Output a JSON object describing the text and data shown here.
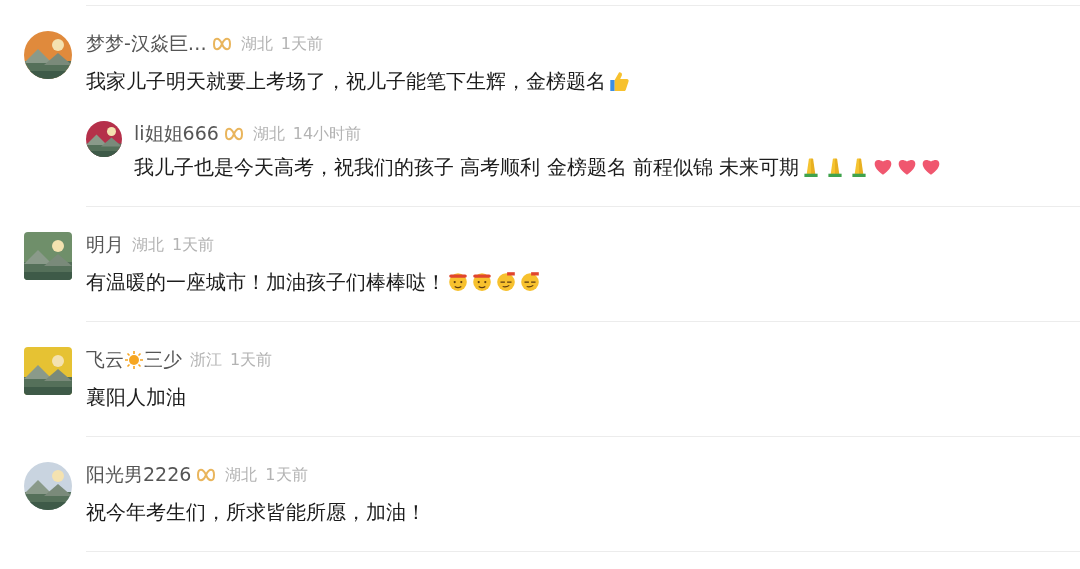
{
  "comments": [
    {
      "avatar": {
        "kind": "round"
      },
      "vip": true,
      "name": [
        {
          "kind": "text",
          "text": "梦梦-汉焱巨…"
        }
      ],
      "location": "湖北",
      "time": "1天前",
      "content": [
        {
          "kind": "text",
          "text": "我家儿子明天就要上考场了，祝儿子能笔下生辉，金榜题名"
        },
        {
          "kind": "thumb"
        }
      ],
      "replies": [
        {
          "avatar": {
            "kind": "round"
          },
          "vip": true,
          "name": [
            {
              "kind": "text",
              "text": "li姐姐666"
            }
          ],
          "location": "湖北",
          "time": "14小时前",
          "content": [
            {
              "kind": "text",
              "text": "我儿子也是今天高考，祝我们的孩子 高考顺利 金榜题名 前程似锦  未来可期"
            },
            {
              "kind": "pray"
            },
            {
              "kind": "pray"
            },
            {
              "kind": "pray"
            },
            {
              "kind": "heart"
            },
            {
              "kind": "heart"
            },
            {
              "kind": "heart"
            }
          ]
        }
      ]
    },
    {
      "avatar": {
        "kind": "rounded-square"
      },
      "vip": false,
      "name": [
        {
          "kind": "text",
          "text": "明月"
        }
      ],
      "location": "湖北",
      "time": "1天前",
      "content": [
        {
          "kind": "text",
          "text": "有温暖的一座城市！加油孩子们棒棒哒！"
        },
        {
          "kind": "cheer"
        },
        {
          "kind": "cheer"
        },
        {
          "kind": "smug"
        },
        {
          "kind": "smug"
        }
      ]
    },
    {
      "avatar": {
        "kind": "rounded-square"
      },
      "vip": false,
      "name": [
        {
          "kind": "text",
          "text": "飞云"
        },
        {
          "kind": "sun"
        },
        {
          "kind": "text",
          "text": "三少"
        }
      ],
      "location": "浙江",
      "time": "1天前",
      "content": [
        {
          "kind": "text",
          "text": "襄阳人加油"
        }
      ]
    },
    {
      "avatar": {
        "kind": "round"
      },
      "vip": true,
      "name": [
        {
          "kind": "text",
          "text": "阳光男2226"
        }
      ],
      "location": "湖北",
      "time": "1天前",
      "content": [
        {
          "kind": "text",
          "text": "祝今年考生们，所求皆能所愿，加油！"
        }
      ]
    }
  ]
}
